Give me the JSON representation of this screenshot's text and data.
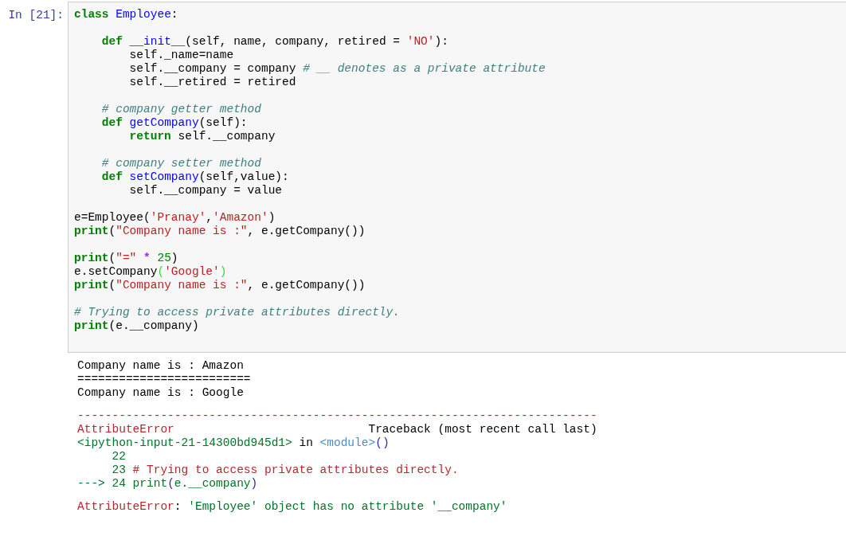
{
  "cell": {
    "prompt": "In [21]:",
    "code_blocks": [
      [
        [
          {
            "text": "class",
            "kind": "kw"
          },
          {
            "text": " Employee",
            "kind": "name"
          },
          {
            "text": ":",
            "kind": "plain"
          }
        ]
      ],
      [
        [
          {
            "text": "    def",
            "kind": "kw"
          },
          {
            "text": " __init__",
            "kind": "name"
          },
          {
            "text": "(self, name, company, retired = ",
            "kind": "plain"
          },
          {
            "text": "'NO'",
            "kind": "str"
          },
          {
            "text": "):",
            "kind": "plain"
          }
        ],
        [
          {
            "text": "        self._name=name",
            "kind": "plain"
          }
        ],
        [
          {
            "text": "        self.__company = company ",
            "kind": "plain"
          },
          {
            "text": "# __ denotes as a private attribute",
            "kind": "cm"
          }
        ],
        [
          {
            "text": "        self.__retired = retired",
            "kind": "plain"
          }
        ]
      ],
      [
        [
          {
            "text": "    # company getter method",
            "kind": "cm"
          }
        ],
        [
          {
            "text": "    def",
            "kind": "kw"
          },
          {
            "text": " getCompany",
            "kind": "name"
          },
          {
            "text": "(self):",
            "kind": "plain"
          }
        ],
        [
          {
            "text": "        return",
            "kind": "kw"
          },
          {
            "text": " self.__company",
            "kind": "plain"
          }
        ]
      ],
      [
        [
          {
            "text": "    # company setter method",
            "kind": "cm"
          }
        ],
        [
          {
            "text": "    def",
            "kind": "kw"
          },
          {
            "text": " setCompany",
            "kind": "name"
          },
          {
            "text": "(self,value):",
            "kind": "plain"
          }
        ],
        [
          {
            "text": "        self.__company = value",
            "kind": "plain"
          }
        ]
      ],
      [
        [
          {
            "text": "e=Employee(",
            "kind": "plain"
          },
          {
            "text": "'Pranay'",
            "kind": "str"
          },
          {
            "text": ",",
            "kind": "plain"
          },
          {
            "text": "'Amazon'",
            "kind": "str"
          },
          {
            "text": ")",
            "kind": "plain"
          }
        ],
        [
          {
            "text": "print",
            "kind": "kw"
          },
          {
            "text": "(",
            "kind": "plain"
          },
          {
            "text": "\"Company name is :\"",
            "kind": "str"
          },
          {
            "text": ", e.getCompany())",
            "kind": "plain"
          }
        ]
      ],
      [
        [
          {
            "text": "print",
            "kind": "kw"
          },
          {
            "text": "(",
            "kind": "plain"
          },
          {
            "text": "\"=\"",
            "kind": "str"
          },
          {
            "text": " * ",
            "kind": "op"
          },
          {
            "text": "25",
            "kind": "num"
          },
          {
            "text": ")",
            "kind": "plain"
          }
        ],
        [
          {
            "text": "e.setCompany",
            "kind": "plain"
          },
          {
            "text": "(",
            "kind": "match"
          },
          {
            "text": "'Google'",
            "kind": "str"
          },
          {
            "text": ")",
            "kind": "match"
          }
        ],
        [
          {
            "text": "print",
            "kind": "kw"
          },
          {
            "text": "(",
            "kind": "plain"
          },
          {
            "text": "\"Company name is :\"",
            "kind": "str"
          },
          {
            "text": ", e.getCompany())",
            "kind": "plain"
          }
        ]
      ],
      [
        [
          {
            "text": "# Trying to access private attributes directly.",
            "kind": "cm"
          }
        ],
        [
          {
            "text": "print",
            "kind": "kw"
          },
          {
            "text": "(e.__company)",
            "kind": "plain"
          }
        ]
      ]
    ],
    "output_blocks": [
      [
        [
          {
            "text": "Company name is : Amazon",
            "kind": "plain"
          }
        ],
        [
          {
            "text": "=========================",
            "kind": "plain"
          }
        ],
        [
          {
            "text": "Company name is : Google",
            "kind": "plain"
          }
        ]
      ],
      [
        [
          {
            "text": "---------------------------------------------------------------------------",
            "kind": "ansi_red"
          }
        ],
        [
          {
            "text": "AttributeError",
            "kind": "ansi_red"
          },
          {
            "text": "                            Traceback (most recent call last)",
            "kind": "plain"
          }
        ],
        [
          {
            "text": "<ipython-input-21-14300bd945d1>",
            "kind": "ansi_green"
          },
          {
            "text": " in ",
            "kind": "plain"
          },
          {
            "text": "<module>",
            "kind": "ansi_cyan"
          },
          {
            "text": "()",
            "kind": "ansi_blue"
          }
        ],
        [
          {
            "text": "     22",
            "kind": "ansi_green"
          }
        ],
        [
          {
            "text": "     23",
            "kind": "ansi_green"
          },
          {
            "text": " # Trying to access private attributes directly.",
            "kind": "ansi_red"
          }
        ],
        [
          {
            "text": "---> 24 print",
            "kind": "ansi_green"
          },
          {
            "text": "(",
            "kind": "ansi_blue"
          },
          {
            "text": "e.__company",
            "kind": "ansi_green"
          },
          {
            "text": ")",
            "kind": "ansi_blue"
          }
        ]
      ],
      [
        [
          {
            "text": "AttributeError",
            "kind": "ansi_red"
          },
          {
            "text": ": ",
            "kind": "plain"
          },
          {
            "text": "'Employee' object has no attribute '__company'",
            "kind": "ansi_green"
          }
        ]
      ]
    ]
  }
}
